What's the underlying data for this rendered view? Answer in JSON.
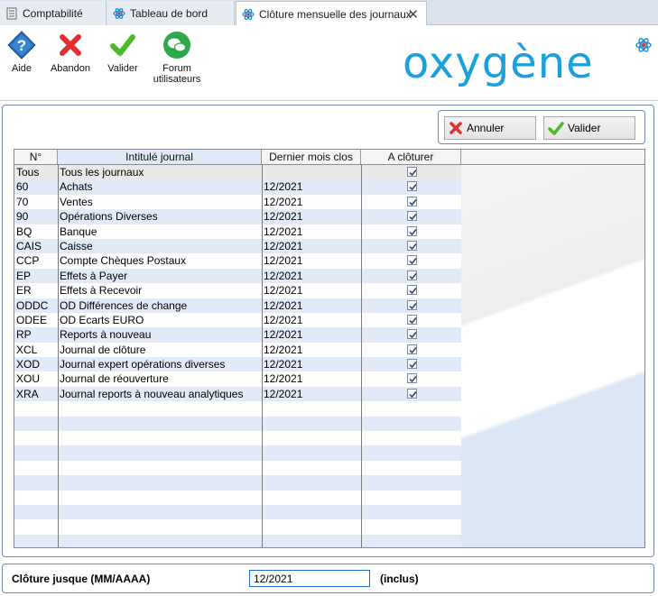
{
  "tabs": [
    {
      "label": "Comptabilité",
      "icon": "ledger-icon"
    },
    {
      "label": "Tableau de bord",
      "icon": "atom-icon"
    },
    {
      "label": "Clôture mensuelle des journaux",
      "icon": "atom-icon",
      "active": true
    }
  ],
  "toolbar": {
    "help_label": "Aide",
    "abandon_label": "Abandon",
    "validate_label": "Valider",
    "forum_label_line1": "Forum",
    "forum_label_line2": "utilisateurs"
  },
  "logo_text": "oxygène",
  "actions": {
    "cancel_label": "Annuler",
    "validate_label": "Valider"
  },
  "grid": {
    "headers": {
      "code": "N°",
      "label": "Intitulé journal",
      "last_month": "Dernier mois clos",
      "to_close": "A clôturer"
    },
    "rows": [
      {
        "code": "Tous",
        "label": "Tous les journaux",
        "last_month": "",
        "checked": true
      },
      {
        "code": "60",
        "label": "Achats",
        "last_month": "12/2021",
        "checked": true
      },
      {
        "code": "70",
        "label": "Ventes",
        "last_month": "12/2021",
        "checked": true
      },
      {
        "code": "90",
        "label": "Opérations Diverses",
        "last_month": "12/2021",
        "checked": true
      },
      {
        "code": "BQ",
        "label": "Banque",
        "last_month": "12/2021",
        "checked": true
      },
      {
        "code": "CAIS",
        "label": "Caisse",
        "last_month": "12/2021",
        "checked": true
      },
      {
        "code": "CCP",
        "label": "Compte Chèques Postaux",
        "last_month": "12/2021",
        "checked": true
      },
      {
        "code": "EP",
        "label": "Effets à Payer",
        "last_month": "12/2021",
        "checked": true
      },
      {
        "code": "ER",
        "label": "Effets à Recevoir",
        "last_month": "12/2021",
        "checked": true
      },
      {
        "code": "ODDC",
        "label": "OD Différences de change",
        "last_month": "12/2021",
        "checked": true
      },
      {
        "code": "ODEE",
        "label": "OD Ecarts EURO",
        "last_month": "12/2021",
        "checked": true
      },
      {
        "code": "RP",
        "label": "Reports à nouveau",
        "last_month": "12/2021",
        "checked": true
      },
      {
        "code": "XCL",
        "label": "Journal de clôture",
        "last_month": "12/2021",
        "checked": true
      },
      {
        "code": "XOD",
        "label": "Journal expert opérations diverses",
        "last_month": "12/2021",
        "checked": true
      },
      {
        "code": "XOU",
        "label": "Journal de réouverture",
        "last_month": "12/2021",
        "checked": true
      },
      {
        "code": "XRA",
        "label": "Journal reports à nouveau analytiques",
        "last_month": "12/2021",
        "checked": true
      }
    ]
  },
  "closing": {
    "label": "Clôture jusque (MM/AAAA)",
    "value": "12/2021",
    "suffix": "(inclus)"
  }
}
